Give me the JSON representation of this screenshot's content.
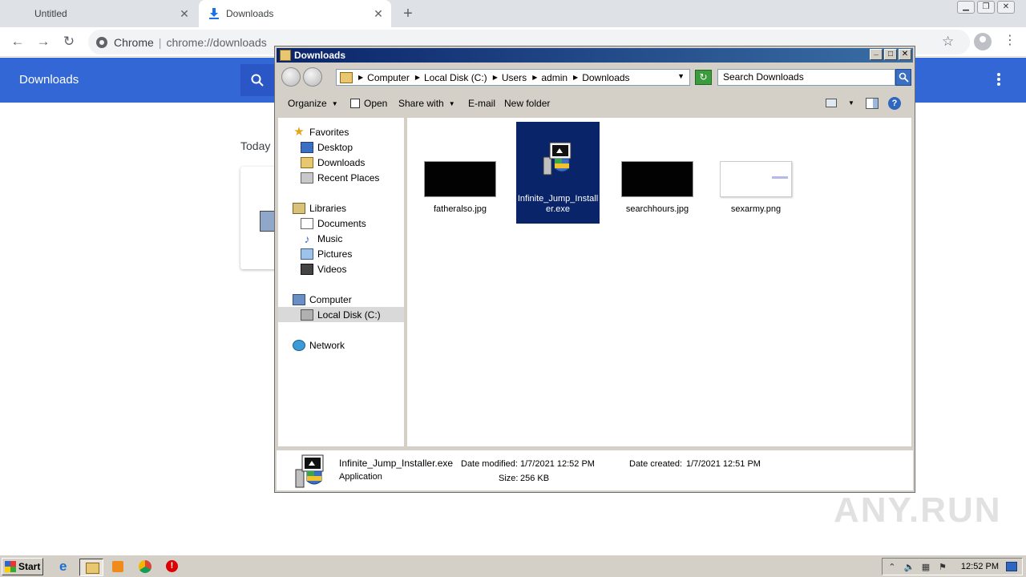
{
  "chrome": {
    "tabs": [
      {
        "label": "Untitled",
        "active": false
      },
      {
        "label": "Downloads",
        "active": true
      }
    ],
    "omnibox": {
      "site": "Chrome",
      "url": "chrome://downloads"
    },
    "page": {
      "title": "Downloads",
      "section": "Today"
    }
  },
  "explorer": {
    "title": "Downloads",
    "breadcrumb": [
      "Computer",
      "Local Disk (C:)",
      "Users",
      "admin",
      "Downloads"
    ],
    "search_placeholder": "Search Downloads",
    "commands": {
      "organize": "Organize",
      "open": "Open",
      "share_with": "Share with",
      "email": "E-mail",
      "new_folder": "New folder"
    },
    "nav": {
      "favorites": "Favorites",
      "desktop": "Desktop",
      "downloads": "Downloads",
      "recent_places": "Recent Places",
      "libraries": "Libraries",
      "documents": "Documents",
      "music": "Music",
      "pictures": "Pictures",
      "videos": "Videos",
      "computer": "Computer",
      "local_disk": "Local Disk (C:)",
      "network": "Network"
    },
    "files": [
      {
        "name": "fatheralso.jpg",
        "thumb": "black",
        "selected": false
      },
      {
        "name": "Infinite_Jump_Installer.exe",
        "thumb": "installer",
        "selected": true
      },
      {
        "name": "searchhours.jpg",
        "thumb": "black",
        "selected": false
      },
      {
        "name": "sexarmy.png",
        "thumb": "white",
        "selected": false
      }
    ],
    "details": {
      "name": "Infinite_Jump_Installer.exe",
      "type": "Application",
      "date_modified_label": "Date modified:",
      "date_modified": "1/7/2021 12:52 PM",
      "date_created_label": "Date created:",
      "date_created": "1/7/2021 12:51 PM",
      "size_label": "Size:",
      "size": "256 KB"
    }
  },
  "taskbar": {
    "start": "Start",
    "clock": "12:52 PM"
  },
  "watermark": "ANY.RUN",
  "colors": {
    "chrome_header": "#3367d6",
    "selection": "#0a246a",
    "win_face": "#d4d0c8"
  }
}
